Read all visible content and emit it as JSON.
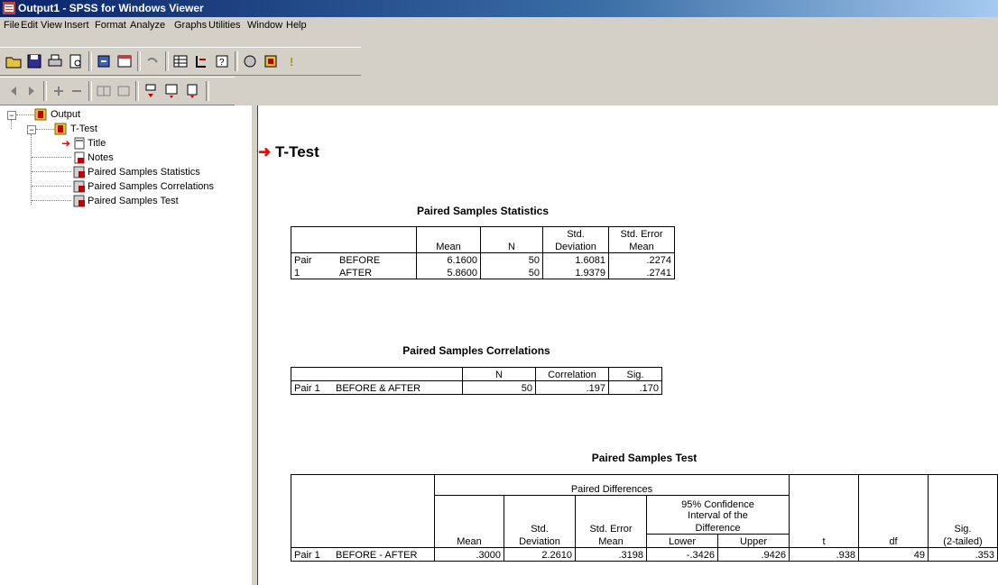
{
  "window": {
    "title": "Output1 - SPSS for Windows Viewer"
  },
  "menu": [
    "File",
    "Edit",
    "View",
    "Insert",
    "Format",
    "Analyze",
    "Graphs",
    "Utilities",
    "Window",
    "Help"
  ],
  "toolbar1_icons": [
    "open-icon",
    "save-icon",
    "print-icon",
    "print-preview-icon",
    "export-icon",
    "recall-dialog-icon",
    "undo-icon",
    "goto-data-icon",
    "goto-case-icon",
    "variables-icon",
    "use-sets-icon",
    "designate-window-icon",
    "stop-icon"
  ],
  "toolbar2_icons": [
    "promote-icon",
    "demote-icon",
    "expand-icon",
    "collapse-icon",
    "show-icon",
    "hide-icon",
    "insert-heading-icon",
    "insert-title-icon",
    "insert-text-icon"
  ],
  "outline": {
    "root": "Output",
    "group": "T-Test",
    "items": [
      "Title",
      "Notes",
      "Paired Samples Statistics",
      "Paired Samples Correlations",
      "Paired Samples Test"
    ]
  },
  "content": {
    "heading": "T-Test",
    "stats": {
      "title": "Paired Samples Statistics",
      "headers": {
        "mean": "Mean",
        "n": "N",
        "sd1": "Std.",
        "sd2": "Deviation",
        "se1": "Std. Error",
        "se2": "Mean"
      },
      "pair_a": "Pair",
      "pair_b": "1",
      "rows": [
        {
          "var": "BEFORE",
          "mean": "6.1600",
          "n": "50",
          "sd": "1.6081",
          "se": ".2274"
        },
        {
          "var": "AFTER",
          "mean": "5.8600",
          "n": "50",
          "sd": "1.9379",
          "se": ".2741"
        }
      ]
    },
    "corr": {
      "title": "Paired Samples Correlations",
      "headers": {
        "n": "N",
        "corr": "Correlation",
        "sig": "Sig."
      },
      "row": {
        "pair": "Pair 1",
        "label": "BEFORE & AFTER",
        "n": "50",
        "corr": ".197",
        "sig": ".170"
      }
    },
    "test": {
      "title": "Paired Samples Test",
      "headers": {
        "paired_diff": "Paired Differences",
        "ci1": "95% Confidence",
        "ci2": "Interval of the",
        "ci3": "Difference",
        "mean": "Mean",
        "sd1": "Std.",
        "sd2": "Deviation",
        "se1": "Std. Error",
        "se2": "Mean",
        "lower": "Lower",
        "upper": "Upper",
        "t": "t",
        "df": "df",
        "sig1": "Sig.",
        "sig2": "(2-tailed)"
      },
      "row": {
        "pair": "Pair 1",
        "label": "BEFORE - AFTER",
        "mean": ".3000",
        "sd": "2.2610",
        "se": ".3198",
        "lower": "-.3426",
        "upper": ".9426",
        "t": ".938",
        "df": "49",
        "sig": ".353"
      }
    }
  },
  "colors": {
    "title_start": "#0a246a",
    "title_end": "#a6caf0",
    "arrow": "#ff0000",
    "face": "#d4d0c8"
  }
}
